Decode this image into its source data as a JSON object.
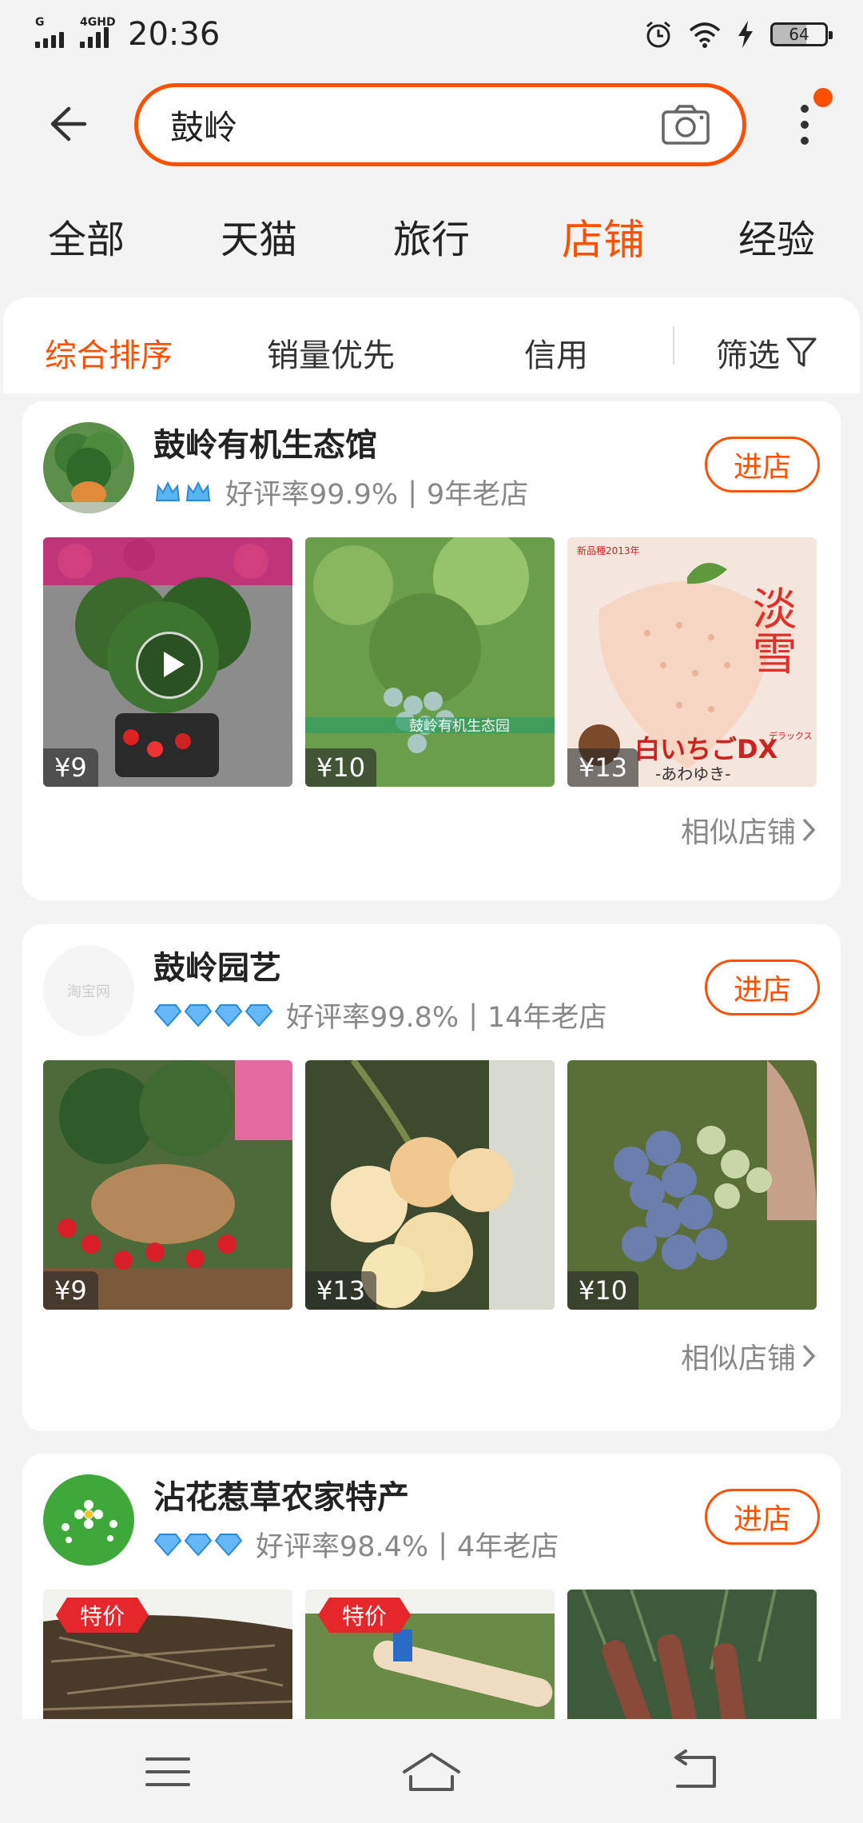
{
  "status_bar": {
    "network_1": "G",
    "network_2": "4GHD",
    "time": "20:36",
    "battery": "64"
  },
  "search": {
    "query": "鼓岭"
  },
  "tabs": [
    {
      "label": "全部"
    },
    {
      "label": "天猫"
    },
    {
      "label": "旅行"
    },
    {
      "label": "店铺"
    },
    {
      "label": "经验"
    }
  ],
  "sort": {
    "comprehensive": "综合排序",
    "sales": "销量优先",
    "credit": "信用",
    "filter": "筛选"
  },
  "shops": [
    {
      "name": "鼓岭有机生态馆",
      "rating": "好评率99.9%",
      "years": "9年老店",
      "enter": "进店",
      "similar": "相似店铺",
      "badge_type": "crown",
      "badge_count": 2,
      "products": [
        {
          "price": "¥9",
          "has_video": true
        },
        {
          "price": "¥10",
          "watermark": "鼓岭有机生态园"
        },
        {
          "price": "¥13",
          "title_jp": "白いちごDX",
          "label_cn": "淡雪",
          "label_year": "新品種2013年",
          "sub_jp": "-あわゆき-",
          "mark_jp": "デラックス"
        }
      ]
    },
    {
      "name": "鼓岭园艺",
      "rating": "好评率99.8%",
      "years": "14年老店",
      "enter": "进店",
      "similar": "相似店铺",
      "avatar_text": "淘宝网",
      "badge_type": "diamond",
      "badge_count": 4,
      "products": [
        {
          "price": "¥9"
        },
        {
          "price": "¥13"
        },
        {
          "price": "¥10"
        }
      ]
    },
    {
      "name": "沾花惹草农家特产",
      "rating": "好评率98.4%",
      "years": "4年老店",
      "enter": "进店",
      "badge_type": "diamond",
      "badge_count": 3,
      "products": [
        {
          "tag": "特价"
        },
        {
          "tag": "特价"
        },
        {}
      ]
    }
  ],
  "colors": {
    "accent": "#ff5000",
    "background": "#f3f3f3",
    "special_tag": "#e5262b"
  }
}
